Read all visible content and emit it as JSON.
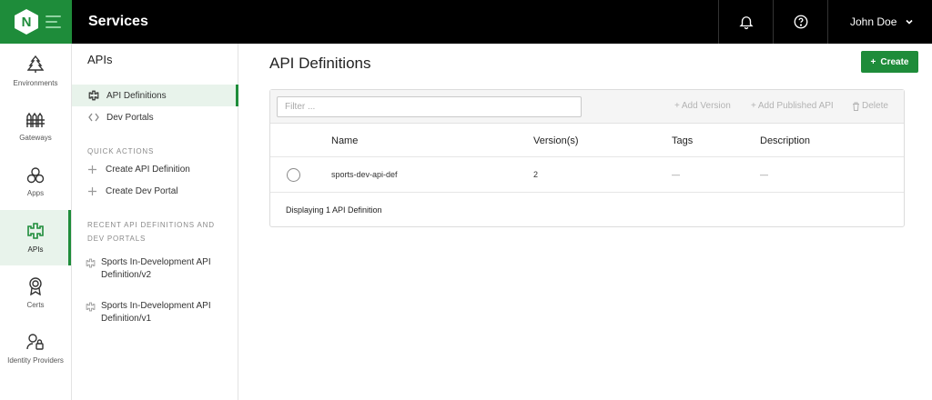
{
  "app": {
    "logo_letter": "N",
    "title": "Services",
    "user_name": "John Doe",
    "accent_color": "#1e8c3a"
  },
  "rail": {
    "items": [
      {
        "label": "Environments",
        "icon": "tree-icon"
      },
      {
        "label": "Gateways",
        "icon": "gateway-icon"
      },
      {
        "label": "Apps",
        "icon": "apps-icon"
      },
      {
        "label": "APIs",
        "icon": "api-icon",
        "active": true
      },
      {
        "label": "Certs",
        "icon": "certificate-icon"
      },
      {
        "label": "Identity Providers",
        "icon": "identity-icon"
      }
    ]
  },
  "subnav": {
    "title": "APIs",
    "links": [
      {
        "label": "API Definitions",
        "icon": "api-icon",
        "active": true
      },
      {
        "label": "Dev Portals",
        "icon": "code-brackets-icon"
      }
    ],
    "quick_actions_label": "QUICK ACTIONS",
    "quick_actions": [
      {
        "label": "Create API Definition",
        "icon": "plus-icon"
      },
      {
        "label": "Create Dev Portal",
        "icon": "plus-icon"
      }
    ],
    "recent_label": "RECENT API DEFINITIONS AND DEV PORTALS",
    "recent": [
      {
        "label": "Sports In-Development API Definition/v2",
        "icon": "api-icon"
      },
      {
        "label": "Sports In-Development API Definition/v1",
        "icon": "api-icon"
      }
    ]
  },
  "main": {
    "title": "API Definitions",
    "create_label": "Create",
    "filter_placeholder": "Filter ...",
    "actions": {
      "add_version": "Add Version",
      "add_published": "Add Published API",
      "delete": "Delete"
    },
    "columns": [
      "Name",
      "Version(s)",
      "Tags",
      "Description"
    ],
    "rows": [
      {
        "name": "sports-dev-api-def",
        "versions": "2",
        "tags": "—",
        "description": "—"
      }
    ],
    "footer": "Displaying 1 API Definition"
  }
}
